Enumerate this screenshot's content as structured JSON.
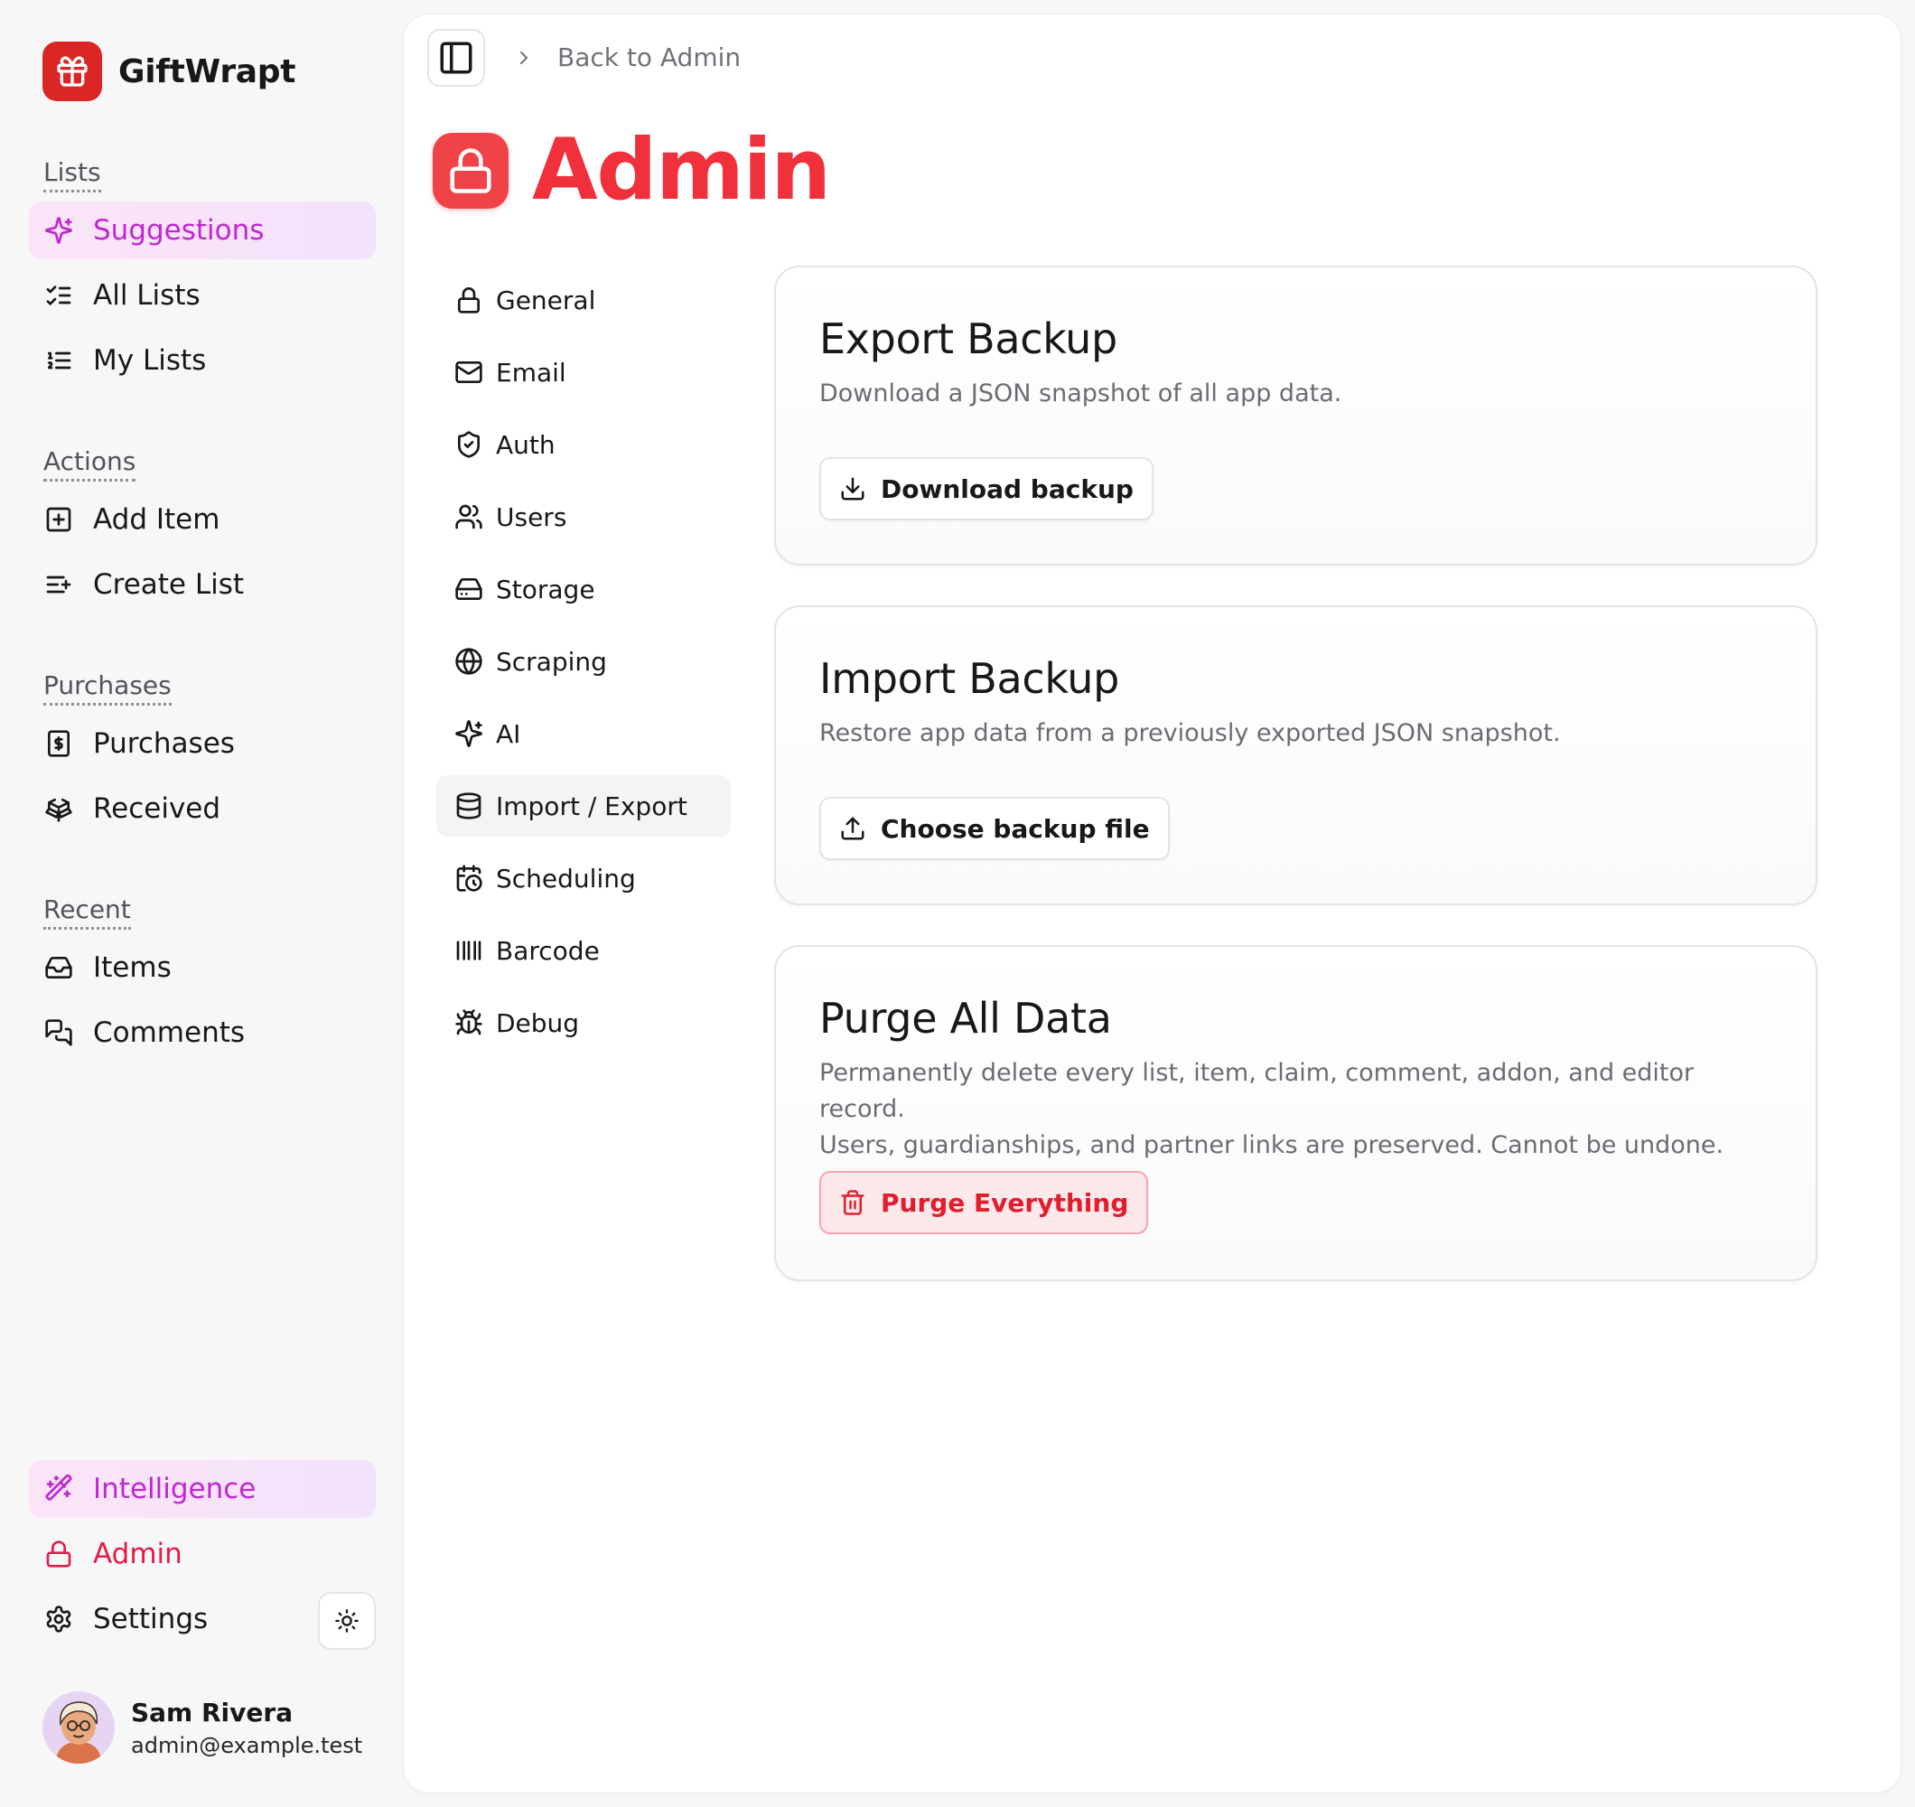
{
  "app": {
    "name": "GiftWrapt"
  },
  "sidebar": {
    "sections": {
      "lists": "Lists",
      "actions": "Actions",
      "purchases": "Purchases",
      "recent": "Recent"
    },
    "items": {
      "suggestions": "Suggestions",
      "all_lists": "All Lists",
      "my_lists": "My Lists",
      "add_item": "Add Item",
      "create_list": "Create List",
      "purchases": "Purchases",
      "received": "Received",
      "items": "Items",
      "comments": "Comments",
      "intelligence": "Intelligence",
      "admin": "Admin",
      "settings": "Settings"
    },
    "user": {
      "name": "Sam Rivera",
      "email": "admin@example.test"
    }
  },
  "header": {
    "breadcrumb": "Back to Admin",
    "title": "Admin"
  },
  "subnav": [
    {
      "label": "General",
      "icon": "lock-icon"
    },
    {
      "label": "Email",
      "icon": "mail-icon"
    },
    {
      "label": "Auth",
      "icon": "shield-icon"
    },
    {
      "label": "Users",
      "icon": "users-icon"
    },
    {
      "label": "Storage",
      "icon": "hard-drive-icon"
    },
    {
      "label": "Scraping",
      "icon": "globe-icon"
    },
    {
      "label": "AI",
      "icon": "sparkles-icon"
    },
    {
      "label": "Import / Export",
      "icon": "database-icon",
      "active": true
    },
    {
      "label": "Scheduling",
      "icon": "calendar-clock-icon"
    },
    {
      "label": "Barcode",
      "icon": "barcode-icon"
    },
    {
      "label": "Debug",
      "icon": "bug-icon"
    }
  ],
  "cards": {
    "export": {
      "title": "Export Backup",
      "description": "Download a JSON snapshot of all app data.",
      "button": "Download backup"
    },
    "import": {
      "title": "Import Backup",
      "description": "Restore app data from a previously exported JSON snapshot.",
      "button": "Choose backup file"
    },
    "purge": {
      "title": "Purge All Data",
      "description_line1": "Permanently delete every list, item, claim, comment, addon, and editor record.",
      "description_line2": "Users, guardianships, and partner links are preserved. Cannot be undone.",
      "button": "Purge Everything"
    }
  },
  "colors": {
    "brand_red": "#dc2626",
    "admin_red": "#f0303b",
    "accent_magenta": "#c026d3",
    "danger_bg": "#fde8ea"
  }
}
